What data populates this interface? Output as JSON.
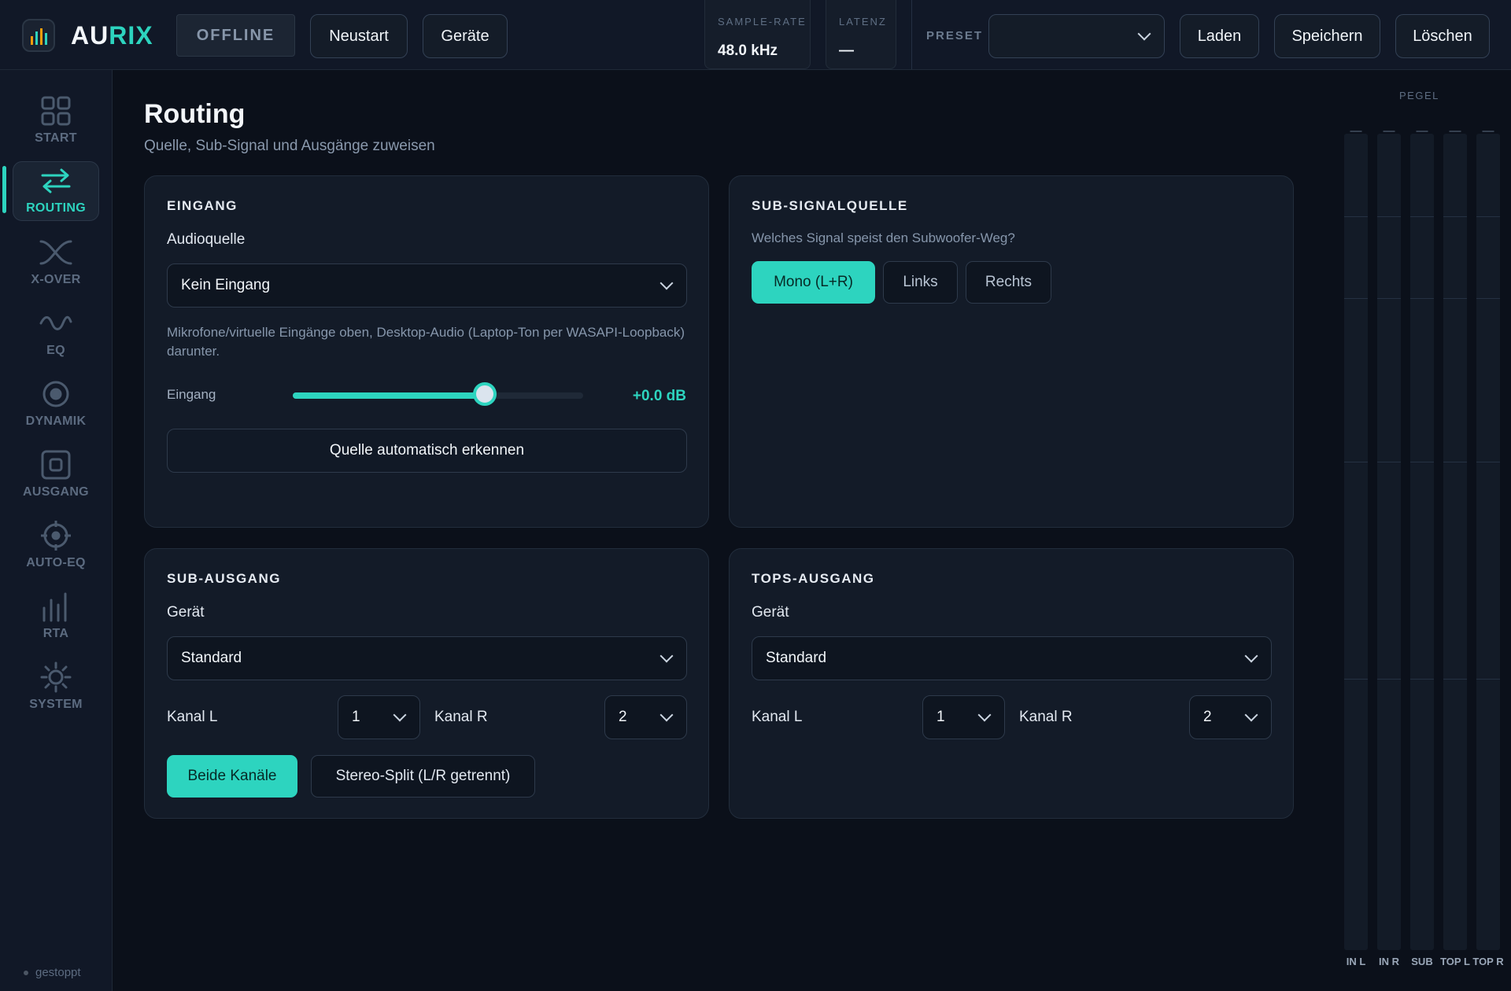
{
  "app": {
    "logo_prefix": "AU",
    "logo_suffix": "RIX",
    "accent_color": "#2dd4bf"
  },
  "topbar": {
    "status": "OFFLINE",
    "restart_label": "Neustart",
    "devices_label": "Geräte",
    "sample_rate_label": "SAMPLE-RATE",
    "sample_rate_value": "48.0 kHz",
    "latency_label": "LATENZ",
    "latency_value": "—",
    "preset_label": "PRESET",
    "preset_value": "",
    "load_label": "Laden",
    "save_label": "Speichern",
    "delete_label": "Löschen"
  },
  "sidebar": {
    "items": [
      {
        "label": "START",
        "icon": "grid-icon"
      },
      {
        "label": "ROUTING",
        "icon": "swap-arrows-icon",
        "active": true
      },
      {
        "label": "X-OVER",
        "icon": "crossover-icon"
      },
      {
        "label": "EQ",
        "icon": "wave-icon"
      },
      {
        "label": "DYNAMIK",
        "icon": "target-circle-icon"
      },
      {
        "label": "AUSGANG",
        "icon": "output-square-icon"
      },
      {
        "label": "AUTO-EQ",
        "icon": "crosshair-icon"
      },
      {
        "label": "RTA",
        "icon": "bars-icon"
      },
      {
        "label": "SYSTEM",
        "icon": "sun-gear-icon"
      }
    ],
    "status": "gestoppt"
  },
  "page": {
    "title": "Routing",
    "subtitle": "Quelle, Sub-Signal und Ausgänge zuweisen"
  },
  "input_card": {
    "title": "EINGANG",
    "source_label": "Audioquelle",
    "source_value": "Kein Eingang",
    "hint": "Mikrofone/virtuelle Eingänge oben, Desktop-Audio (Laptop-Ton per WASAPI-Loopback) darunter.",
    "gain_label": "Eingang",
    "gain_value": "+0.0 dB",
    "gain_fraction": 0.66,
    "auto_detect_label": "Quelle automatisch erkennen"
  },
  "sub_source_card": {
    "title": "SUB-SIGNALQUELLE",
    "question": "Welches Signal speist den Subwoofer-Weg?",
    "options": [
      "Mono (L+R)",
      "Links",
      "Rechts"
    ],
    "selected": "Mono (L+R)"
  },
  "sub_output_card": {
    "title": "SUB-AUSGANG",
    "device_label": "Gerät",
    "device_value": "Standard",
    "channel_l_label": "Kanal L",
    "channel_l_value": "1",
    "channel_r_label": "Kanal R",
    "channel_r_value": "2",
    "mode_both_label": "Beide Kanäle",
    "mode_split_label": "Stereo-Split (L/R getrennt)",
    "selected_mode": "Beide Kanäle"
  },
  "tops_output_card": {
    "title": "TOPS-AUSGANG",
    "device_label": "Gerät",
    "device_value": "Standard",
    "channel_l_label": "Kanal L",
    "channel_l_value": "1",
    "channel_r_label": "Kanal R",
    "channel_r_value": "2"
  },
  "meters": {
    "title": "PEGEL",
    "channels": [
      {
        "name": "IN L",
        "peak": "—"
      },
      {
        "name": "IN R",
        "peak": "—"
      },
      {
        "name": "SUB",
        "peak": "—"
      },
      {
        "name": "TOP L",
        "peak": "—"
      },
      {
        "name": "TOP R",
        "peak": "—"
      }
    ]
  }
}
